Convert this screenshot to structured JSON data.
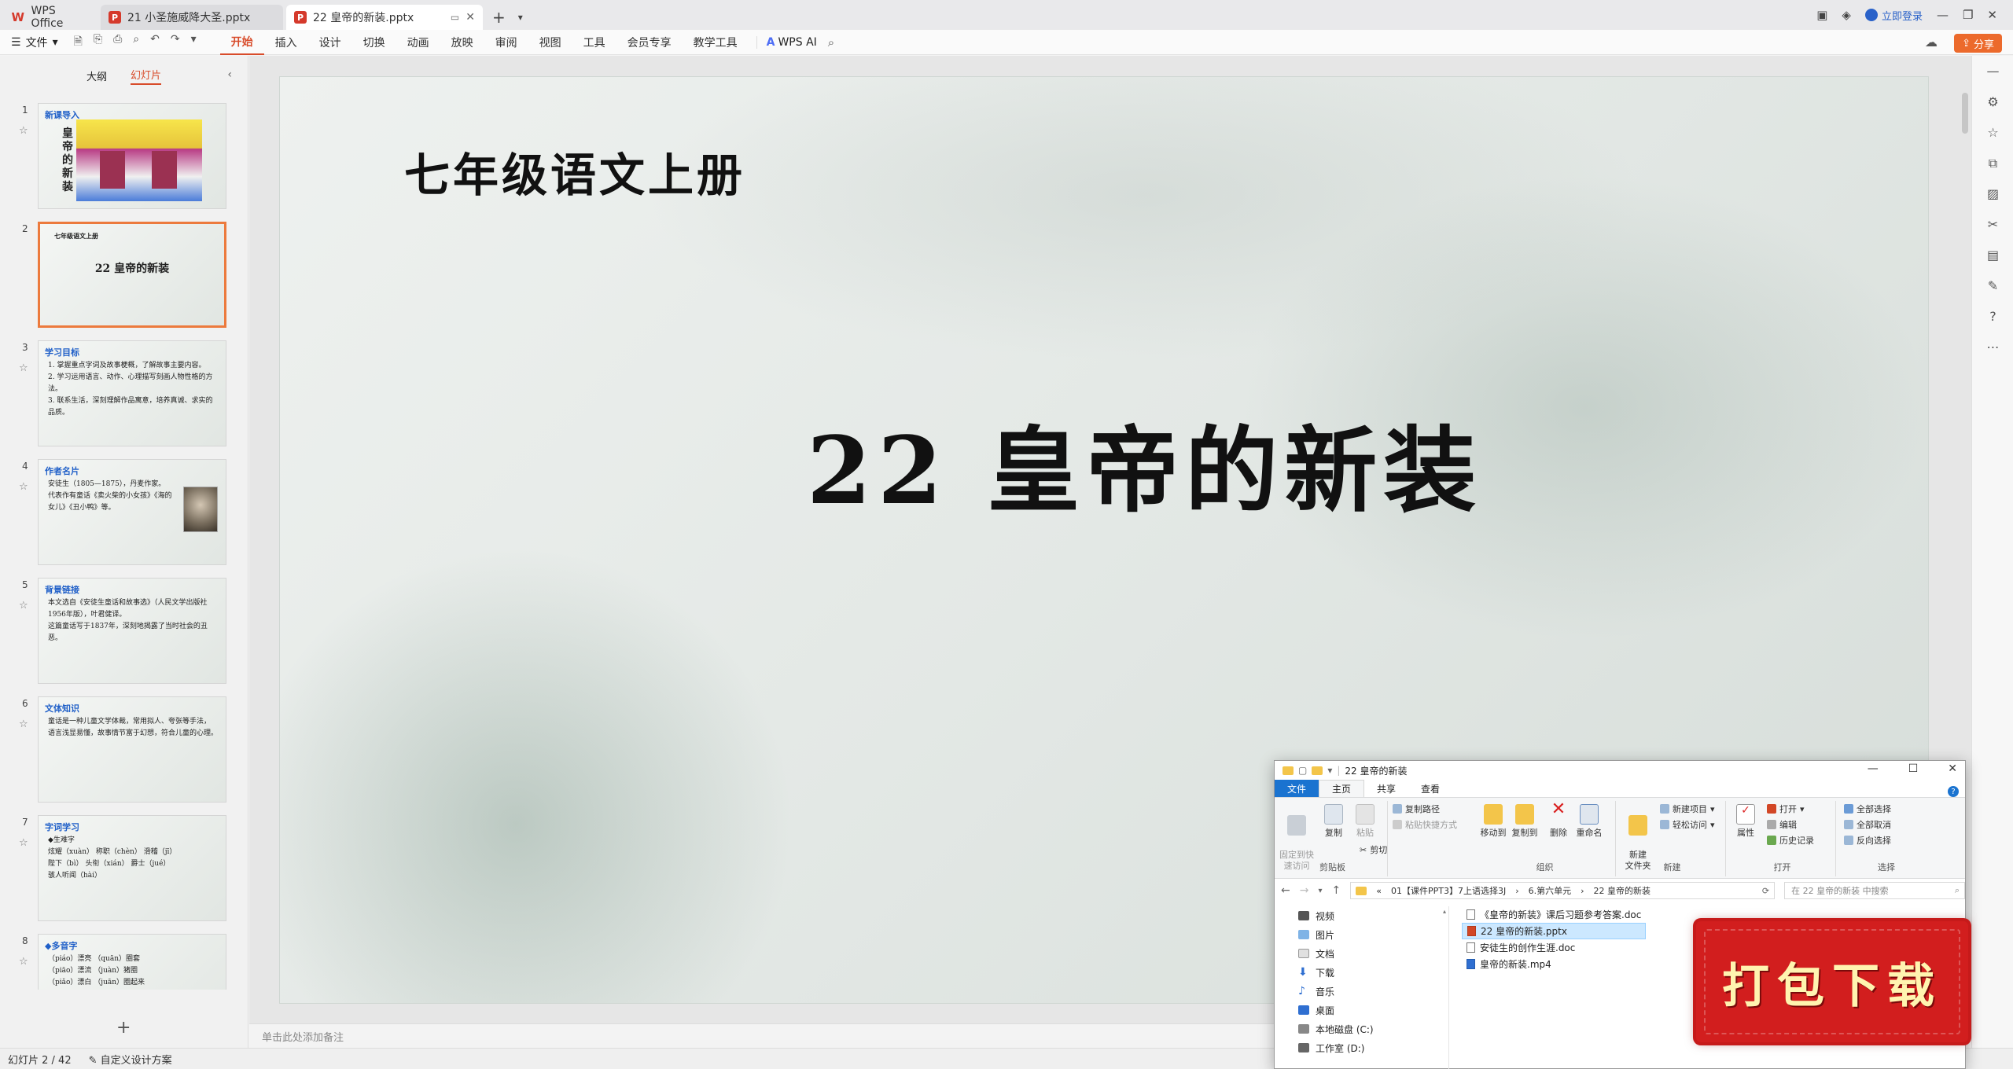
{
  "tabs": {
    "home": "WPS Office",
    "doc1": "21 小圣施威降大圣.pptx",
    "doc2": "22 皇帝的新装.pptx"
  },
  "window": {
    "login": "立即登录",
    "share": "分享"
  },
  "menu": {
    "file": "文件",
    "tabs": [
      "开始",
      "插入",
      "设计",
      "切换",
      "动画",
      "放映",
      "审阅",
      "视图",
      "工具",
      "会员专享",
      "教学工具"
    ],
    "ai": "WPS AI"
  },
  "leftpane": {
    "view_outline": "大纲",
    "view_slides": "幻灯片"
  },
  "thumbs": [
    {
      "num": "1",
      "head": "新课导入",
      "vert": "皇帝的新装"
    },
    {
      "num": "2",
      "small": "七年级语文上册",
      "title": "22 皇帝的新装"
    },
    {
      "num": "3",
      "head": "学习目标",
      "lines": [
        "1. 掌握重点字词及故事梗概，了解故事主要内容。",
        "2. 学习运用语言、动作、心理描写刻画人物性格的方法。",
        "3. 联系生活，深刻理解作品寓意，培养真诚、求实的品质。"
      ]
    },
    {
      "num": "4",
      "head": "作者名片",
      "lines": [
        "安徒生（1805—1875），丹麦作家。",
        "代表作有童话《卖火柴的小女孩》《海的女儿》《丑小鸭》等。"
      ]
    },
    {
      "num": "5",
      "head": "背景链接",
      "lines": [
        "本文选自《安徒生童话和故事选》（人民文学出版社1956年版），叶君健译。",
        "这篇童话写于1837年，深刻地揭露了当时社会的丑恶。"
      ]
    },
    {
      "num": "6",
      "head": "文体知识",
      "lines": [
        "童话是一种儿童文学体裁，常用拟人、夸张等手法，",
        "语言浅显易懂，故事情节富于幻想，符合儿童的心理。"
      ]
    },
    {
      "num": "7",
      "head": "字词学习",
      "lines": [
        "◆生难字",
        "炫耀（xuàn）  称职（chèn）  滑稽（jī）",
        "陛下（bì）  头衔（xián）  爵士（jué）",
        "骇人听闻（hài）"
      ]
    },
    {
      "num": "8",
      "head": "◆多音字",
      "lines": [
        "（piáo）漂亮   （quān）圈套",
        "（piāo）漂流   （juàn）猪圈",
        "（piǎo）漂白   （juān）圈起来"
      ]
    }
  ],
  "slide": {
    "subtitle": "七年级语文上册",
    "title": "22  皇帝的新装"
  },
  "notes_placeholder": "单击此处添加备注",
  "status": {
    "slide_count": "幻灯片 2 / 42",
    "design": "自定义设计方案"
  },
  "explorer": {
    "title": "22 皇帝的新装",
    "tabs": [
      "文件",
      "主页",
      "共享",
      "查看"
    ],
    "ribbon": {
      "pin": "固定到快\n速访问",
      "copy": "复制",
      "paste": "粘贴",
      "copy_path": "复制路径",
      "paste_shortcut": "粘贴快捷方式",
      "cut": "剪切",
      "clipboard": "剪贴板",
      "move_to": "移动到",
      "copy_to": "复制到",
      "delete": "删除",
      "rename": "重命名",
      "organize": "组织",
      "new_folder": "新建\n文件夹",
      "new_item": "新建项目",
      "easy_access": "轻松访问",
      "new": "新建",
      "properties": "属性",
      "open": "打开",
      "edit": "编辑",
      "history": "历史记录",
      "open_group": "打开",
      "select_all": "全部选择",
      "select_none": "全部取消",
      "invert": "反向选择",
      "select": "选择"
    },
    "path": [
      "01【课件PPT3】7上语选择3J",
      "6.第六单元",
      "22 皇帝的新装"
    ],
    "search_placeholder": "在 22 皇帝的新装 中搜索",
    "tree": [
      "视频",
      "图片",
      "文档",
      "下载",
      "音乐",
      "桌面",
      "本地磁盘 (C:)",
      "工作室 (D:)"
    ],
    "files": [
      "《皇帝的新装》课后习题参考答案.doc",
      "22 皇帝的新装.pptx",
      "安徒生的创作生涯.doc",
      "皇帝的新装.mp4"
    ]
  },
  "stamp": "打包下载"
}
